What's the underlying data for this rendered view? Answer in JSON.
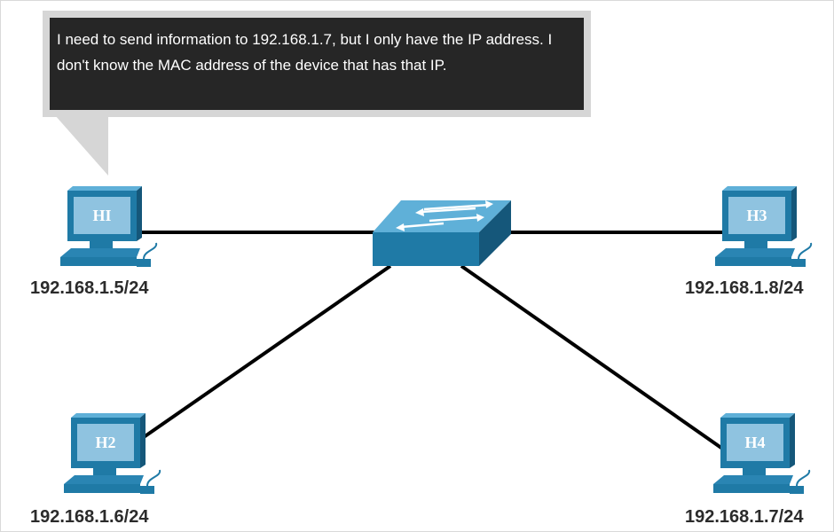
{
  "callout": {
    "text": "I need to send information to 192.168.1.7, but I only have the IP address. I don't know the MAC address of the device that has that IP."
  },
  "hosts": [
    {
      "id": "h1",
      "name": "HI",
      "ip": "192.168.1.5/24"
    },
    {
      "id": "h2",
      "name": "H2",
      "ip": "192.168.1.6/24"
    },
    {
      "id": "h3",
      "name": "H3",
      "ip": "192.168.1.8/24"
    },
    {
      "id": "h4",
      "name": "H4",
      "ip": "192.168.1.7/24"
    }
  ],
  "colors": {
    "device_dark": "#1d6f97",
    "device_mid": "#2a85b3",
    "device_light": "#5fb0d8",
    "screen": "#8fc3e0",
    "link": "#000000"
  }
}
